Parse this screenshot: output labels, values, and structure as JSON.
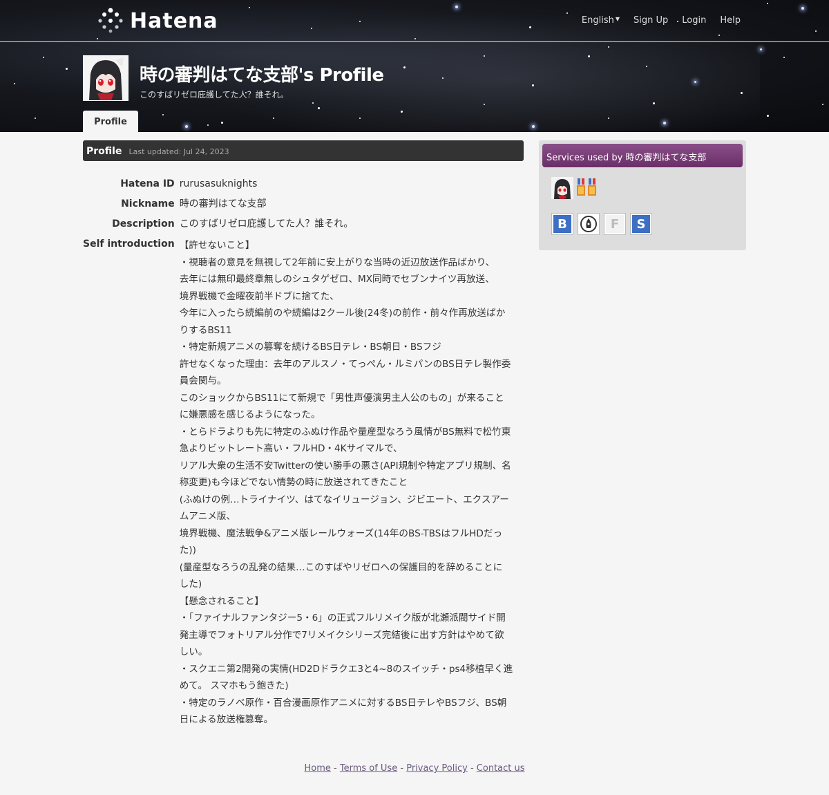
{
  "header": {
    "logo_text": "Hatena",
    "nav": [
      {
        "label": "English",
        "has_dropdown": true
      },
      {
        "label": "Sign Up"
      },
      {
        "label": "Login"
      },
      {
        "label": "Help"
      }
    ]
  },
  "profile": {
    "title": "時の審判はてな支部's Profile",
    "tagline": "このすばリゼロ庇護してた人？誰それ。",
    "tab_label": "Profile"
  },
  "main": {
    "heading": "Profile",
    "last_updated": "Last updated: Jul 24, 2023",
    "rows": [
      {
        "label": "Hatena ID",
        "value": "rurusasuknights"
      },
      {
        "label": "Nickname",
        "value": "時の審判はてな支部"
      },
      {
        "label": "Description",
        "value": "このすばリゼロ庇護してた人？誰それ。"
      }
    ],
    "self_intro_label": "Self introduction",
    "self_intro_lines": [
      "【許せないこと】",
      "・視聴者の意見を無視して2年前に安上がりな当時の近辺放送作品ばかり、",
      "去年には無印最終章無しのシュタゲゼロ、MX同時でセブンナイツ再放送、",
      "境界戦機で金曜夜前半ドブに捨てた、",
      "今年に入ったら続編前のや続編は2クール後(24冬)の前作・前々作再放送ばか",
      "りするBS11",
      "・特定新規アニメの篡奪を続けるBS日テレ・BS朝日・BSフジ",
      "許せなくなった理由：去年のアルスノ・てっぺん・ルミパンのBS日テレ製作委",
      "員会関与。",
      "このショックからBS11にて新規で「男性声優演男主人公のもの」が来ること",
      "に嫌悪感を感じるようになった。",
      "・とらドラよりも先に特定のふぬけ作品や量産型なろう風情がBS無料で松竹東",
      "急よりビットレート高い・フルHD・4Kサイマルで、",
      "リアル大衆の生活不安Twitterの使い勝手の悪さ(API規制や特定アプリ規制、名",
      "称変更)も今ほどでない情勢の時に放送されてきたこと",
      "(ふぬけの例…トライナイツ、はてなイリュージョン、ジビエート、エクスアー",
      "ムアニメ版、",
      "境界戦機、魔法戦争&アニメ版レールウォーズ(14年のBS-TBSはフルHDだっ",
      "た))",
      "(量産型なろうの乱発の結果…このすばやリゼロへの保護目的を辞めることに",
      "した)",
      "【懸念されること】",
      "・「ファイナルファンタジー5・6」の正式フルリメイク版が北瀬派閥サイド開",
      "発主導でフォトリアル分作で7リメイクシリーズ完結後に出す方針はやめて欲",
      "しい。",
      "・スクエニ第2開発の実情(HD2Dドラクエ3と4~8のスイッチ・ps4移植早く進",
      "めて。 スマホもう飽きた)",
      "・特定のラノベ原作・百合漫画原作アニメに対するBS日テレやBSフジ、BS朝",
      "日による放送権篡奪。"
    ]
  },
  "sidebar": {
    "services_heading": "Services used by 時の審判はてな支部",
    "services": [
      {
        "icon": "hatena-bookmark-icon",
        "letter": "B",
        "color": "#3d6fc4"
      },
      {
        "icon": "hatena-blog-icon",
        "letter": "",
        "color": "#333333"
      },
      {
        "icon": "hatena-fotolife-icon",
        "letter": "F",
        "color": "#bbbbbb"
      },
      {
        "icon": "hatena-star-icon",
        "letter": "S",
        "color": "#3d6fc4"
      }
    ]
  },
  "footer": {
    "links": [
      "Home",
      "Terms of Use",
      "Privacy Policy",
      "Contact us"
    ],
    "separator": "-"
  }
}
